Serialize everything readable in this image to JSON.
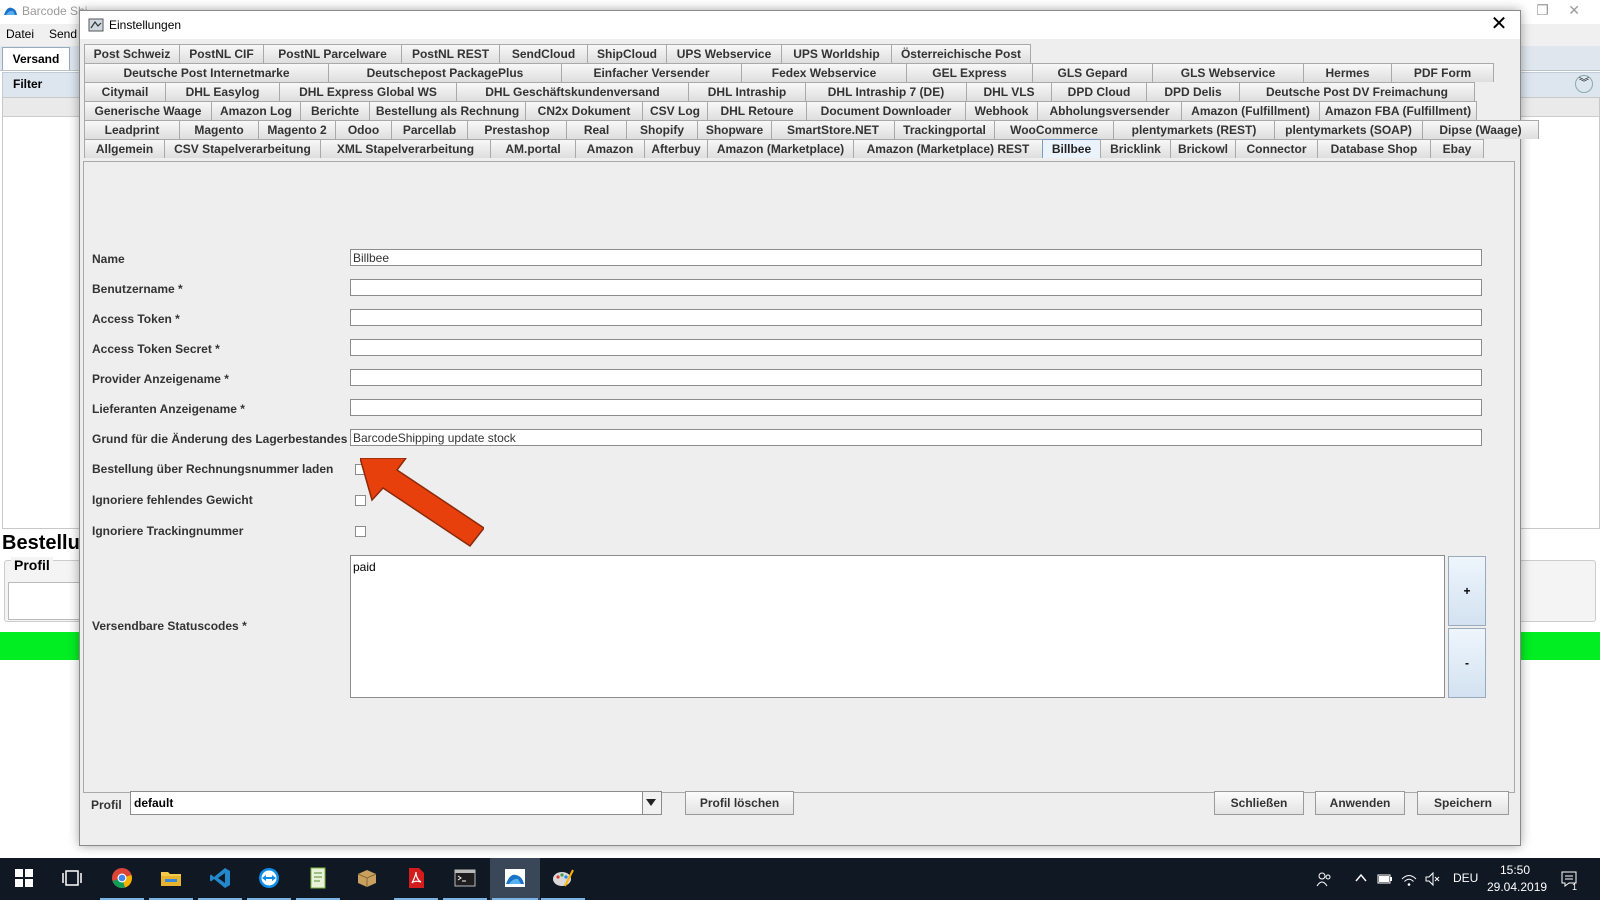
{
  "background_app": {
    "title": "Barcode Shi",
    "menu": [
      "Datei",
      "Send"
    ],
    "tab": "Versand",
    "filter_label": "Filter",
    "section_title": "Bestellu",
    "profile_label": "Profil"
  },
  "dialog": {
    "title": "Einstellungen",
    "tab_rows": [
      [
        "Post Schweiz",
        "PostNL CIF",
        "PostNL Parcelware",
        "PostNL REST",
        "SendCloud",
        "ShipCloud",
        "UPS Webservice",
        "UPS Worldship",
        "Österreichische Post"
      ],
      [
        "Deutsche Post Internetmarke",
        "Deutschepost PackagePlus",
        "Einfacher Versender",
        "Fedex Webservice",
        "GEL Express",
        "GLS Gepard",
        "GLS Webservice",
        "Hermes",
        "PDF Form"
      ],
      [
        "Citymail",
        "DHL Easylog",
        "DHL Express Global WS",
        "DHL Geschäftskundenversand",
        "DHL Intraship",
        "DHL Intraship 7 (DE)",
        "DHL VLS",
        "DPD Cloud",
        "DPD Delis",
        "Deutsche Post DV Freimachung"
      ],
      [
        "Generische Waage",
        "Amazon Log",
        "Berichte",
        "Bestellung als Rechnung",
        "CN2x Dokument",
        "CSV Log",
        "DHL Retoure",
        "Document Downloader",
        "Webhook",
        "Abholungsversender",
        "Amazon (Fulfillment)",
        "Amazon FBA (Fulfillment)"
      ],
      [
        "Leadprint",
        "Magento",
        "Magento 2",
        "Odoo",
        "Parcellab",
        "Prestashop",
        "Real",
        "Shopify",
        "Shopware",
        "SmartStore.NET",
        "Trackingportal",
        "WooCommerce",
        "plentymarkets (REST)",
        "plentymarkets (SOAP)",
        "Dipse (Waage)"
      ],
      [
        "Allgemein",
        "CSV Stapelverarbeitung",
        "XML Stapelverarbeitung",
        "AM.portal",
        "Amazon",
        "Afterbuy",
        "Amazon (Marketplace)",
        "Amazon (Marketplace) REST",
        "Billbee",
        "Bricklink",
        "Brickowl",
        "Connector",
        "Database Shop",
        "Ebay"
      ]
    ],
    "active_tab": "Billbee",
    "form": {
      "name_label": "Name",
      "name_value": "Billbee",
      "benutzername_label": "Benutzername *",
      "benutzername_value": "",
      "access_token_label": "Access Token *",
      "access_token_value": "",
      "access_token_secret_label": "Access Token Secret *",
      "access_token_secret_value": "",
      "provider_label": "Provider Anzeigename *",
      "provider_value": "",
      "lieferanten_label": "Lieferanten Anzeigename *",
      "lieferanten_value": "",
      "grund_label": "Grund für die Änderung des Lagerbestandes",
      "grund_value": "BarcodeShipping update stock",
      "rechnungsnummer_label": "Bestellung über Rechnungsnummer laden",
      "rechnungsnummer_checked": false,
      "gewicht_label": "Ignoriere fehlendes Gewicht",
      "gewicht_checked": false,
      "tracking_label": "Ignoriere Trackingnummer",
      "tracking_checked": false,
      "statuscodes_label": "Versendbare Statuscodes *",
      "statuscodes_values": [
        "paid"
      ],
      "add_label": "+",
      "remove_label": "-"
    },
    "footer": {
      "profil_label": "Profil",
      "profil_value": "default",
      "delete_profile": "Profil löschen",
      "close": "Schließen",
      "apply": "Anwenden",
      "save": "Speichern"
    },
    "annotation_arrow_color": "#e8400c"
  },
  "taskbar": {
    "icons": [
      "windows-start-icon",
      "task-view-icon",
      "chrome-icon",
      "file-explorer-icon",
      "vscode-icon",
      "teamviewer-icon",
      "notepad-icon",
      "package-icon",
      "acrobat-icon",
      "terminal-icon",
      "barcode-shipping-icon",
      "paint-icon"
    ],
    "language": "DEU",
    "time": "15:50",
    "date": "29.04.2019",
    "notification_count": "1"
  }
}
